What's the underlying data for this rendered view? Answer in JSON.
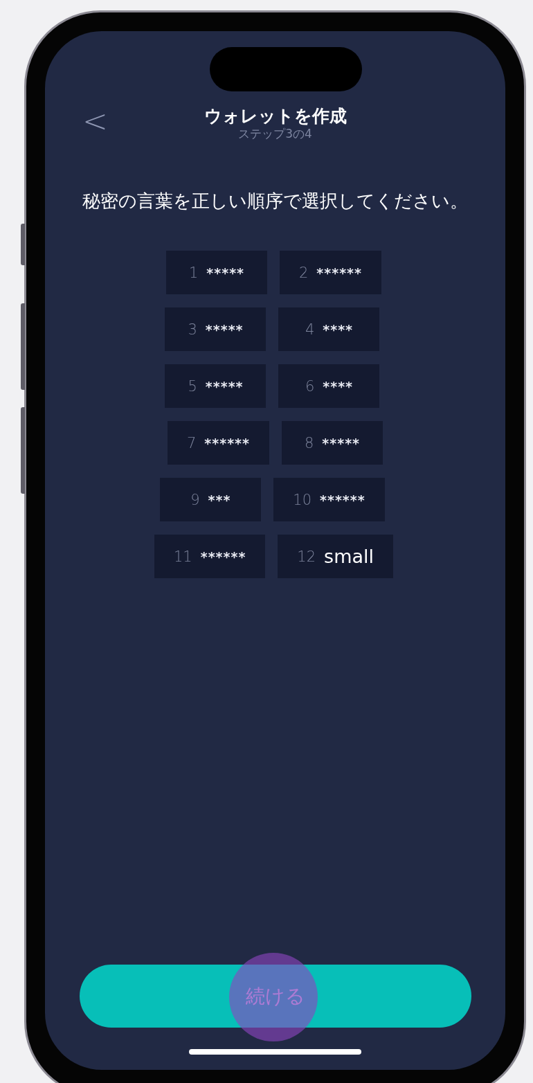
{
  "header": {
    "back": "<",
    "title": "ウォレットを作成",
    "subtitle": "ステップ3の4"
  },
  "instruction": "秘密の言葉を正しい順序で選択してください。",
  "word_rows": [
    [
      {
        "number": "1",
        "word": "*****",
        "revealed": false
      },
      {
        "number": "2",
        "word": "******",
        "revealed": false
      }
    ],
    [
      {
        "number": "3",
        "word": "*****",
        "revealed": false
      },
      {
        "number": "4",
        "word": "****",
        "revealed": false
      }
    ],
    [
      {
        "number": "5",
        "word": "*****",
        "revealed": false
      },
      {
        "number": "6",
        "word": "****",
        "revealed": false
      }
    ],
    [
      {
        "number": "7",
        "word": "******",
        "revealed": false
      },
      {
        "number": "8",
        "word": "*****",
        "revealed": false
      }
    ],
    [
      {
        "number": "9",
        "word": "***",
        "revealed": false
      },
      {
        "number": "10",
        "word": "******",
        "revealed": false
      }
    ],
    [
      {
        "number": "11",
        "word": "******",
        "revealed": false
      },
      {
        "number": "12",
        "word": "small",
        "revealed": true
      }
    ]
  ],
  "continue_button": {
    "label": "続ける"
  },
  "touch_indicator": true
}
